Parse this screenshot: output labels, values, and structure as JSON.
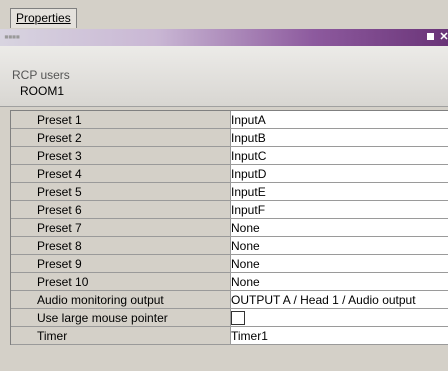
{
  "tabs": {
    "properties": "Properties"
  },
  "panel": {
    "title": "RCP users",
    "subtitle": "ROOM1"
  },
  "properties": [
    {
      "name": "Preset 1",
      "value": "InputA"
    },
    {
      "name": "Preset 2",
      "value": "InputB"
    },
    {
      "name": "Preset 3",
      "value": "InputC"
    },
    {
      "name": "Preset 4",
      "value": "InputD"
    },
    {
      "name": "Preset 5",
      "value": "InputE"
    },
    {
      "name": "Preset 6",
      "value": "InputF"
    },
    {
      "name": "Preset 7",
      "value": "None"
    },
    {
      "name": "Preset 8",
      "value": "None"
    },
    {
      "name": "Preset 9",
      "value": "None"
    },
    {
      "name": "Preset 10",
      "value": "None"
    },
    {
      "name": "Audio monitoring output",
      "value": "OUTPUT A / Head 1 / Audio output"
    },
    {
      "name": "Use large mouse pointer",
      "checked": false
    },
    {
      "name": "Timer",
      "value": "Timer1"
    }
  ],
  "colors": {
    "titlebar_end": "#6a3478",
    "background": "#d4d0c8"
  },
  "icons": {
    "restore": "restore-icon",
    "close": "close-icon",
    "grip": "grip-icon"
  }
}
